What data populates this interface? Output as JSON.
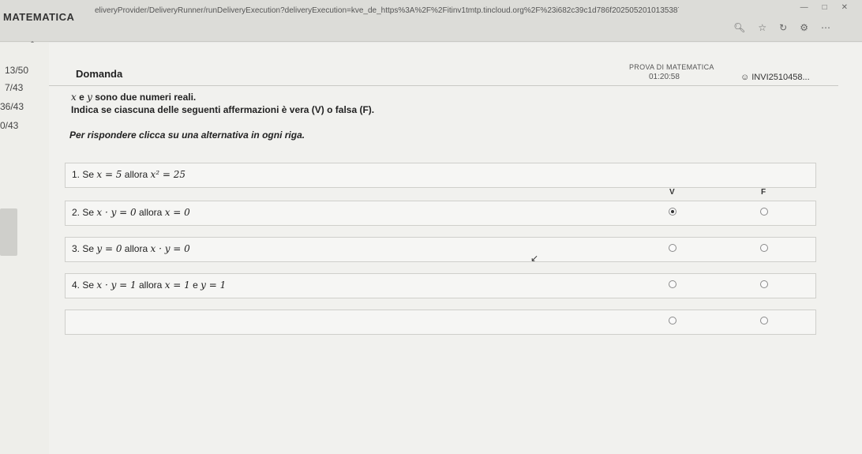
{
  "browser": {
    "app_title": "MATEMATICA",
    "url": "eliveryProvider/DeliveryRunner/runDeliveryExecution?deliveryExecution=kve_de_https%3A%2F%2Fitinv1tmtp.tincloud.org%2F%23i682c39c1d786f20250520101353872863S8"
  },
  "sidebar": {
    "items": [
      "13/50",
      "7/43",
      "36/43",
      "0/43"
    ]
  },
  "header": {
    "title": "Domanda",
    "test_name": "PROVA DI MATEMATICA",
    "timer": "01:20:58",
    "user": "INVI2510458..."
  },
  "intro": {
    "line1_var1": "x",
    "line1_mid": " e ",
    "line1_var2": "y",
    "line1_rest": " sono due numeri reali.",
    "line2": "Indica se ciascuna delle seguenti affermazioni è vera (V) o falsa (F).",
    "line3": "Per rispondere clicca su una alternativa in ogni riga."
  },
  "columns": {
    "true": "V",
    "false": "F"
  },
  "questions": [
    {
      "num": "1. Se ",
      "cond": "x = 5",
      "mid": " allora ",
      "concl": "x² = 25",
      "tail": "",
      "tail_math": "",
      "selected": ""
    },
    {
      "num": "2. Se ",
      "cond": "x · y = 0",
      "mid": " allora ",
      "concl": "x = 0",
      "tail": "",
      "tail_math": "",
      "selected": "V"
    },
    {
      "num": "3. Se ",
      "cond": "y = 0",
      "mid": " allora ",
      "concl": "x · y = 0",
      "tail": "",
      "tail_math": "",
      "selected": ""
    },
    {
      "num": "4. Se ",
      "cond": "x · y = 1",
      "mid": " allora ",
      "concl": "x = 1",
      "tail": " e ",
      "tail_math": "y = 1",
      "selected": ""
    }
  ]
}
